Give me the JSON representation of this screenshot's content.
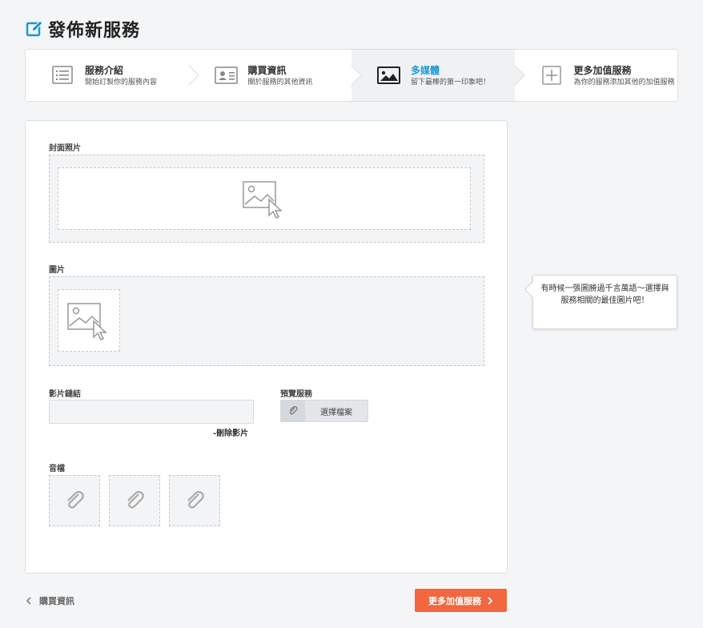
{
  "header": {
    "title": "發佈新服務",
    "icon": "edit-icon",
    "accent": "#1a9ad6"
  },
  "steps": [
    {
      "title": "服務介紹",
      "desc": "開始訂製你的服務內容",
      "icon": "list-icon",
      "active": false
    },
    {
      "title": "購買資訊",
      "desc": "關於服務的其他資訊",
      "icon": "id-card-icon",
      "active": false
    },
    {
      "title": "多媒體",
      "desc": "留下最棒的第一印象吧！",
      "icon": "image-icon",
      "active": true
    },
    {
      "title": "更多加值服務",
      "desc": "為你的服務添加其他的加值服務",
      "icon": "plus-icon",
      "active": false
    }
  ],
  "form": {
    "cover_label": "封面照片",
    "images_label": "圖片",
    "video_label": "影片鏈結",
    "video_value": "",
    "delete_video": "-刪除影片",
    "preview_label": "預覽服務",
    "choose_file": "選擇檔案",
    "audio_label": "音檔"
  },
  "tooltip": {
    "text": "有時候一張圖勝過千言萬語～選擇與服務相關的最佳圖片吧！"
  },
  "footer": {
    "back_label": "購買資訊",
    "next_label": "更多加值服務",
    "next_color": "#f2673f"
  }
}
